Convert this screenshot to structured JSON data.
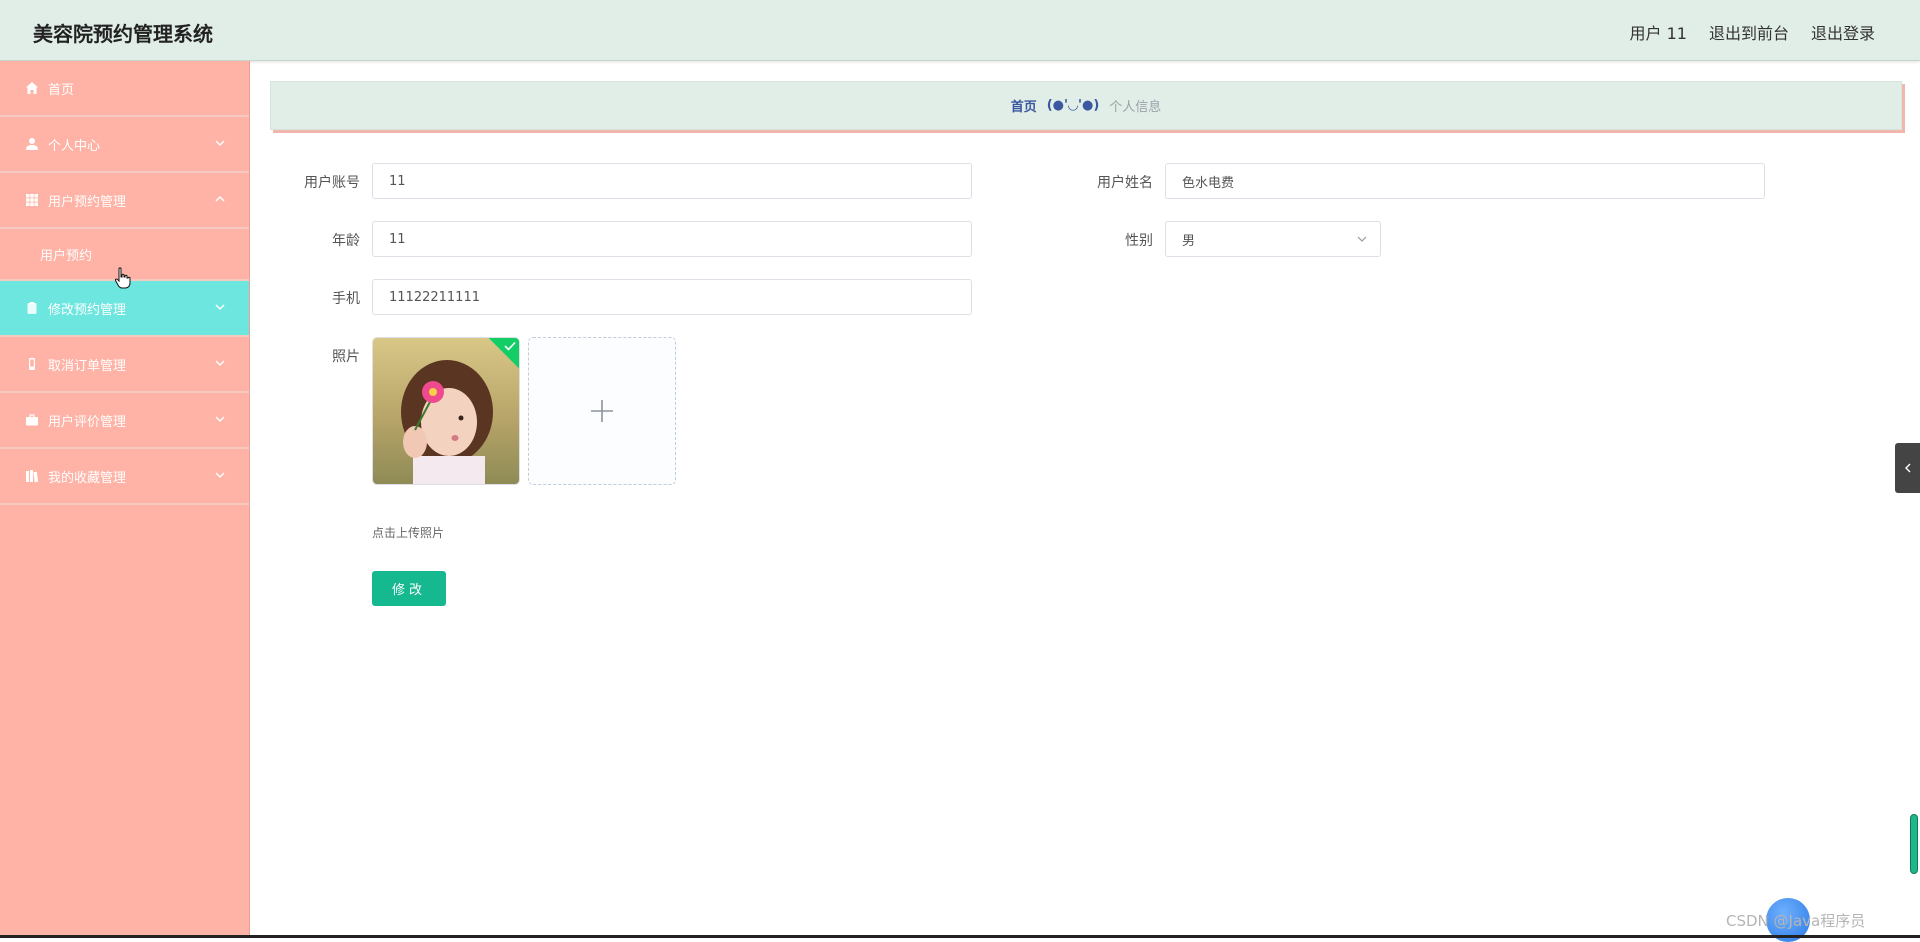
{
  "header": {
    "title": "美容院预约管理系统",
    "user_label": "用户 11",
    "to_front": "退出到前台",
    "logout": "退出登录"
  },
  "sidebar": {
    "items": [
      {
        "label": "首页",
        "icon": "home-icon"
      },
      {
        "label": "个人中心",
        "icon": "user-icon"
      },
      {
        "label": "用户预约管理",
        "icon": "grid-icon",
        "expanded": true
      },
      {
        "label": "修改预约管理",
        "icon": "clipboard-icon",
        "active": true
      },
      {
        "label": "取消订单管理",
        "icon": "phone-icon"
      },
      {
        "label": "用户评价管理",
        "icon": "briefcase-icon"
      },
      {
        "label": "我的收藏管理",
        "icon": "books-icon"
      }
    ],
    "submenu": {
      "label": "用户预约"
    }
  },
  "breadcrumb": {
    "home": "首页",
    "separator": "(●'◡'●)",
    "current": "个人信息"
  },
  "form": {
    "account_label": "用户账号",
    "account_value": "11",
    "name_label": "用户姓名",
    "name_value": "色水电费",
    "age_label": "年龄",
    "age_value": "11",
    "gender_label": "性别",
    "gender_value": "男",
    "phone_label": "手机",
    "phone_value": "11122211111",
    "photo_label": "照片",
    "upload_tip": "点击上传照片",
    "submit_label": "修改"
  },
  "watermark": "CSDN @Java程序员",
  "colors": {
    "header_bg": "#e1eee7",
    "sidebar_bg": "#ffb3a6",
    "active_item": "#6ee6e0",
    "button": "#16b88f",
    "success_badge": "#13ce66"
  }
}
